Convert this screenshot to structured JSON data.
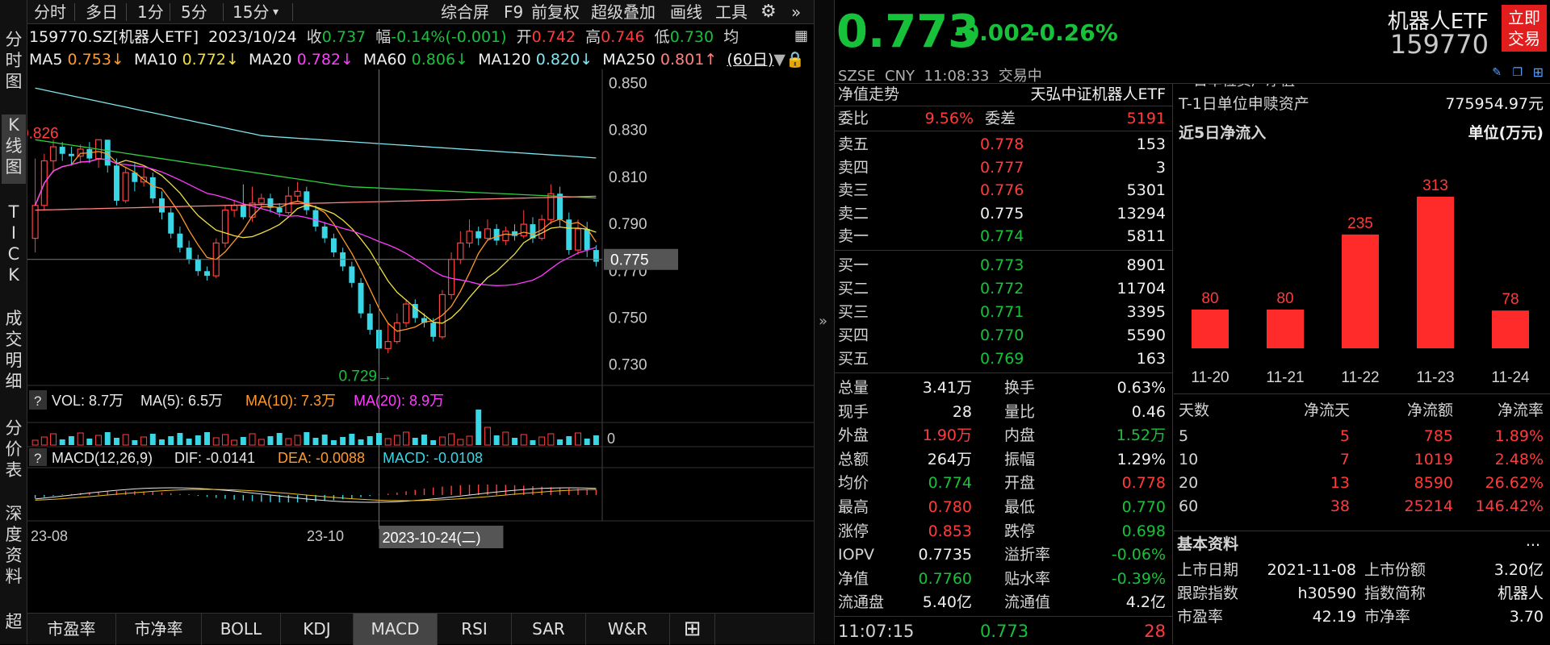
{
  "leftbar": {
    "items": [
      "分时图",
      "K线图",
      "TICK",
      "成交明细",
      "分价表",
      "深度资料",
      "超级盘口"
    ]
  },
  "toolbar": {
    "tabs": [
      "分时",
      "多日",
      "1分",
      "5分",
      "15分"
    ],
    "dropdown_icon": "chevron-down-icon",
    "right_items": [
      "综合屏",
      "F9",
      "前复权",
      "超级叠加",
      "画线",
      "工具"
    ],
    "settings_icon": "gear-icon",
    "collapse_icon": "double-chevron-right-icon"
  },
  "quote_line": {
    "code_name": "159770.SZ[机器人ETF]",
    "date": "2023/10/24",
    "close_label": "收",
    "close": "0.737",
    "range_label": "幅",
    "range": "-0.14%(-0.001)",
    "open_label": "开",
    "open": "0.742",
    "high_label": "高",
    "high": "0.746",
    "low_label": "低",
    "low": "0.730",
    "avg_label": "均"
  },
  "ma_line": {
    "ma5_label": "MA5",
    "ma5": "0.753↓",
    "ma10_label": "MA10",
    "ma10": "0.772↓",
    "ma20_label": "MA20",
    "ma20": "0.782↓",
    "ma60_label": "MA60",
    "ma60": "0.806↓",
    "ma120_label": "MA120",
    "ma120": "0.820↓",
    "ma250_label": "MA250",
    "ma250": "0.801↑",
    "period": "(60日)"
  },
  "price_axis": [
    "0.850",
    "0.830",
    "0.810",
    "0.790",
    "0.770",
    "0.750",
    "0.730"
  ],
  "crosshair_price": "0.775",
  "max_marker": "←0.826",
  "min_marker": "0.729→",
  "vol_line": {
    "q": "?",
    "vol": "VOL: 8.7万",
    "ma5": "MA(5): 6.5万",
    "ma10": "MA(10): 7.3万",
    "ma20": "MA(20): 8.9万",
    "axis": "0"
  },
  "macd_line": {
    "q": "?",
    "label": "MACD(12,26,9)",
    "dif": "DIF: -0.0141",
    "dea": "DEA: -0.0088",
    "macd": "MACD: -0.0108"
  },
  "date_axis": [
    "23-08",
    "23-10"
  ],
  "crosshair_date": "2023-10-24(二)",
  "bottom_tabs": [
    "市盈率",
    "市净率",
    "BOLL",
    "KDJ",
    "MACD",
    "RSI",
    "SAR",
    "W&R"
  ],
  "bottom_tab_active": "MACD",
  "bottom_add_icon": "plus-box-icon",
  "header": {
    "price": "0.773",
    "change": "-0.002",
    "change_pct": "-0.26%",
    "name": "机器人ETF",
    "code": "159770",
    "trade_button": "立即\n交易",
    "market": "SZSE",
    "currency": "CNY",
    "time": "11:08:33",
    "status": "交易中"
  },
  "orderbook": {
    "nav_title": "净值走势",
    "fund_name": "天弘中证机器人ETF",
    "weibi_label": "委比",
    "weibi": "9.56%",
    "weicha_label": "委差",
    "weicha": "5191",
    "asks": [
      {
        "label": "卖五",
        "price": "0.778",
        "vol": "153"
      },
      {
        "label": "卖四",
        "price": "0.777",
        "vol": "3"
      },
      {
        "label": "卖三",
        "price": "0.776",
        "vol": "5301"
      },
      {
        "label": "卖二",
        "price": "0.775",
        "vol": "13294"
      },
      {
        "label": "卖一",
        "price": "0.774",
        "vol": "5811"
      }
    ],
    "bids": [
      {
        "label": "买一",
        "price": "0.773",
        "vol": "8901"
      },
      {
        "label": "买二",
        "price": "0.772",
        "vol": "11704"
      },
      {
        "label": "买三",
        "price": "0.771",
        "vol": "3395"
      },
      {
        "label": "买四",
        "price": "0.770",
        "vol": "5590"
      },
      {
        "label": "买五",
        "price": "0.769",
        "vol": "163"
      }
    ]
  },
  "stats": [
    {
      "l1": "总量",
      "v1": "3.41万",
      "c1": "white",
      "l2": "换手",
      "v2": "0.63%",
      "c2": "white"
    },
    {
      "l1": "现手",
      "v1": "28",
      "c1": "white",
      "l2": "量比",
      "v2": "0.46",
      "c2": "white"
    },
    {
      "l1": "外盘",
      "v1": "1.90万",
      "c1": "red",
      "l2": "内盘",
      "v2": "1.52万",
      "c2": "green"
    },
    {
      "l1": "总额",
      "v1": "264万",
      "c1": "white",
      "l2": "振幅",
      "v2": "1.29%",
      "c2": "white"
    },
    {
      "l1": "均价",
      "v1": "0.774",
      "c1": "green",
      "l2": "开盘",
      "v2": "0.778",
      "c2": "red"
    },
    {
      "l1": "最高",
      "v1": "0.780",
      "c1": "red",
      "l2": "最低",
      "v2": "0.770",
      "c2": "green"
    },
    {
      "l1": "涨停",
      "v1": "0.853",
      "c1": "red",
      "l2": "跌停",
      "v2": "0.698",
      "c2": "green"
    },
    {
      "l1": "IOPV",
      "v1": "0.7735",
      "c1": "white",
      "l2": "溢折率",
      "v2": "-0.06%",
      "c2": "green"
    },
    {
      "l1": "净值",
      "v1": "0.7760",
      "c1": "green",
      "l2": "贴水率",
      "v2": "-0.39%",
      "c2": "green"
    },
    {
      "l1": "流通盘",
      "v1": "5.40亿",
      "c1": "white",
      "l2": "流通值",
      "v2": "4.2亿",
      "c2": "white"
    }
  ],
  "last_trade": {
    "time": "11:07:15",
    "price": "0.773",
    "vol": "28"
  },
  "fund_panel": {
    "top_cut": "一日单位资产净值",
    "nav_label": "T-1日单位申赎资产",
    "nav_value": "775954.97元",
    "flow_title": "近5日净流入",
    "flow_unit": "单位(万元)",
    "bars_labels": [
      "80",
      "80",
      "235",
      "313",
      "78"
    ],
    "dates": [
      "11-20",
      "11-21",
      "11-22",
      "11-23",
      "11-24"
    ],
    "table_headers": [
      "天数",
      "净流天",
      "净流额",
      "净流率"
    ],
    "table_rows": [
      [
        "5",
        "5",
        "785",
        "1.89%"
      ],
      [
        "10",
        "7",
        "1019",
        "2.48%"
      ],
      [
        "20",
        "13",
        "8590",
        "26.62%"
      ],
      [
        "60",
        "38",
        "25214",
        "146.42%"
      ]
    ],
    "basic_title": "基本资料",
    "more": "...",
    "basic": [
      {
        "l1": "上市日期",
        "v1": "2021-11-08",
        "l2": "上市份额",
        "v2": "3.20亿"
      },
      {
        "l1": "跟踪指数",
        "v1": "h30590",
        "l2": "指数简称",
        "v2": "机器人"
      },
      {
        "l1": "市盈率",
        "v1": "42.19",
        "l2": "市净率",
        "v2": "3.70"
      }
    ]
  },
  "chart_data": {
    "type": "bar",
    "title": "近5日净流入",
    "unit": "单位(万元)",
    "categories": [
      "11-20",
      "11-21",
      "11-22",
      "11-23",
      "11-24"
    ],
    "values": [
      80,
      80,
      235,
      313,
      78
    ],
    "color": "#ff2a2a"
  },
  "candles": {
    "note_color_up": "#ff4040",
    "note_color_down": "#39d6e6",
    "data": [
      [
        0.784,
        0.798,
        0.818,
        0.778
      ],
      [
        0.798,
        0.817,
        0.82,
        0.796
      ],
      [
        0.817,
        0.823,
        0.826,
        0.812
      ],
      [
        0.823,
        0.82,
        0.825,
        0.817
      ],
      [
        0.82,
        0.819,
        0.823,
        0.815
      ],
      [
        0.819,
        0.822,
        0.824,
        0.816
      ],
      [
        0.822,
        0.818,
        0.825,
        0.816
      ],
      [
        0.818,
        0.826,
        0.826,
        0.814
      ],
      [
        0.826,
        0.815,
        0.826,
        0.812
      ],
      [
        0.815,
        0.8,
        0.818,
        0.798
      ],
      [
        0.8,
        0.812,
        0.814,
        0.799
      ],
      [
        0.812,
        0.808,
        0.816,
        0.804
      ],
      [
        0.808,
        0.81,
        0.814,
        0.806
      ],
      [
        0.81,
        0.801,
        0.812,
        0.799
      ],
      [
        0.801,
        0.795,
        0.804,
        0.792
      ],
      [
        0.795,
        0.786,
        0.797,
        0.784
      ],
      [
        0.786,
        0.78,
        0.789,
        0.778
      ],
      [
        0.78,
        0.775,
        0.783,
        0.773
      ],
      [
        0.775,
        0.77,
        0.777,
        0.768
      ],
      [
        0.77,
        0.768,
        0.772,
        0.766
      ],
      [
        0.768,
        0.782,
        0.784,
        0.767
      ],
      [
        0.782,
        0.796,
        0.798,
        0.78
      ],
      [
        0.796,
        0.798,
        0.8,
        0.793
      ],
      [
        0.798,
        0.793,
        0.807,
        0.792
      ],
      [
        0.793,
        0.799,
        0.806,
        0.791
      ],
      [
        0.799,
        0.801,
        0.803,
        0.797
      ],
      [
        0.801,
        0.797,
        0.803,
        0.795
      ],
      [
        0.797,
        0.795,
        0.799,
        0.793
      ],
      [
        0.795,
        0.802,
        0.806,
        0.794
      ],
      [
        0.802,
        0.804,
        0.808,
        0.8
      ],
      [
        0.804,
        0.796,
        0.806,
        0.794
      ],
      [
        0.796,
        0.789,
        0.798,
        0.787
      ],
      [
        0.789,
        0.784,
        0.791,
        0.782
      ],
      [
        0.784,
        0.778,
        0.786,
        0.776
      ],
      [
        0.778,
        0.772,
        0.78,
        0.77
      ],
      [
        0.772,
        0.765,
        0.774,
        0.763
      ],
      [
        0.765,
        0.752,
        0.767,
        0.75
      ],
      [
        0.752,
        0.745,
        0.756,
        0.743
      ],
      [
        0.745,
        0.737,
        0.746,
        0.73
      ],
      [
        0.737,
        0.74,
        0.748,
        0.735
      ],
      [
        0.74,
        0.748,
        0.752,
        0.739
      ],
      [
        0.748,
        0.756,
        0.758,
        0.746
      ],
      [
        0.756,
        0.75,
        0.758,
        0.748
      ],
      [
        0.75,
        0.748,
        0.752,
        0.746
      ],
      [
        0.748,
        0.742,
        0.75,
        0.74
      ],
      [
        0.742,
        0.76,
        0.762,
        0.741
      ],
      [
        0.76,
        0.775,
        0.778,
        0.758
      ],
      [
        0.775,
        0.782,
        0.787,
        0.773
      ],
      [
        0.782,
        0.787,
        0.792,
        0.78
      ],
      [
        0.787,
        0.784,
        0.789,
        0.781
      ],
      [
        0.784,
        0.788,
        0.792,
        0.783
      ],
      [
        0.788,
        0.783,
        0.79,
        0.781
      ],
      [
        0.783,
        0.787,
        0.789,
        0.781
      ],
      [
        0.787,
        0.785,
        0.79,
        0.783
      ],
      [
        0.785,
        0.79,
        0.796,
        0.784
      ],
      [
        0.79,
        0.784,
        0.793,
        0.782
      ],
      [
        0.784,
        0.792,
        0.794,
        0.783
      ],
      [
        0.792,
        0.803,
        0.807,
        0.79
      ],
      [
        0.803,
        0.792,
        0.806,
        0.789
      ],
      [
        0.792,
        0.779,
        0.795,
        0.777
      ],
      [
        0.779,
        0.788,
        0.792,
        0.777
      ],
      [
        0.788,
        0.779,
        0.791,
        0.776
      ],
      [
        0.779,
        0.774,
        0.781,
        0.772
      ]
    ]
  }
}
